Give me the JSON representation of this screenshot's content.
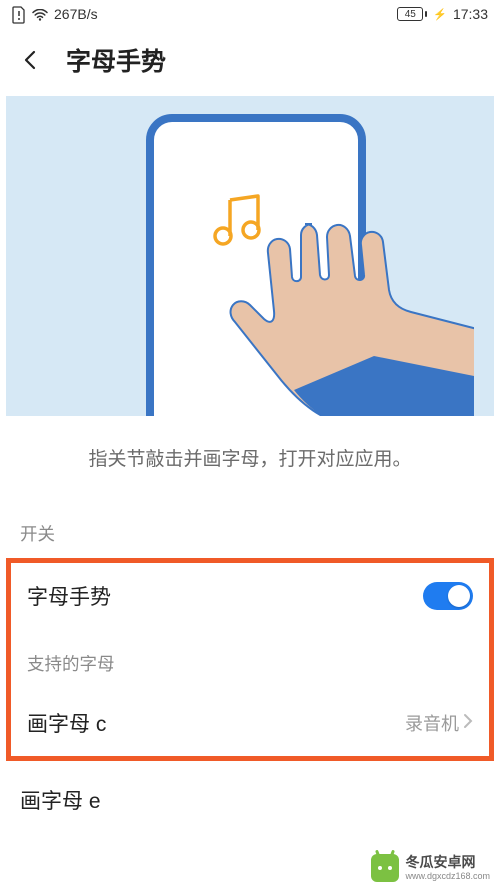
{
  "status": {
    "network_speed": "267B/s",
    "battery_text": "45",
    "time": "17:33"
  },
  "header": {
    "title": "字母手势"
  },
  "illustration": {
    "icon": "music-note"
  },
  "description": "指关节敲击并画字母，打开对应应用。",
  "sections": {
    "switch_label": "开关",
    "toggle": {
      "label": "字母手势",
      "state": "on"
    },
    "supported_label": "支持的字母",
    "items": [
      {
        "label": "画字母 c",
        "value": "录音机"
      },
      {
        "label": "画字母 e",
        "value": ""
      }
    ]
  },
  "watermark": {
    "title": "冬瓜安卓网",
    "url": "www.dgxcdz168.com"
  }
}
